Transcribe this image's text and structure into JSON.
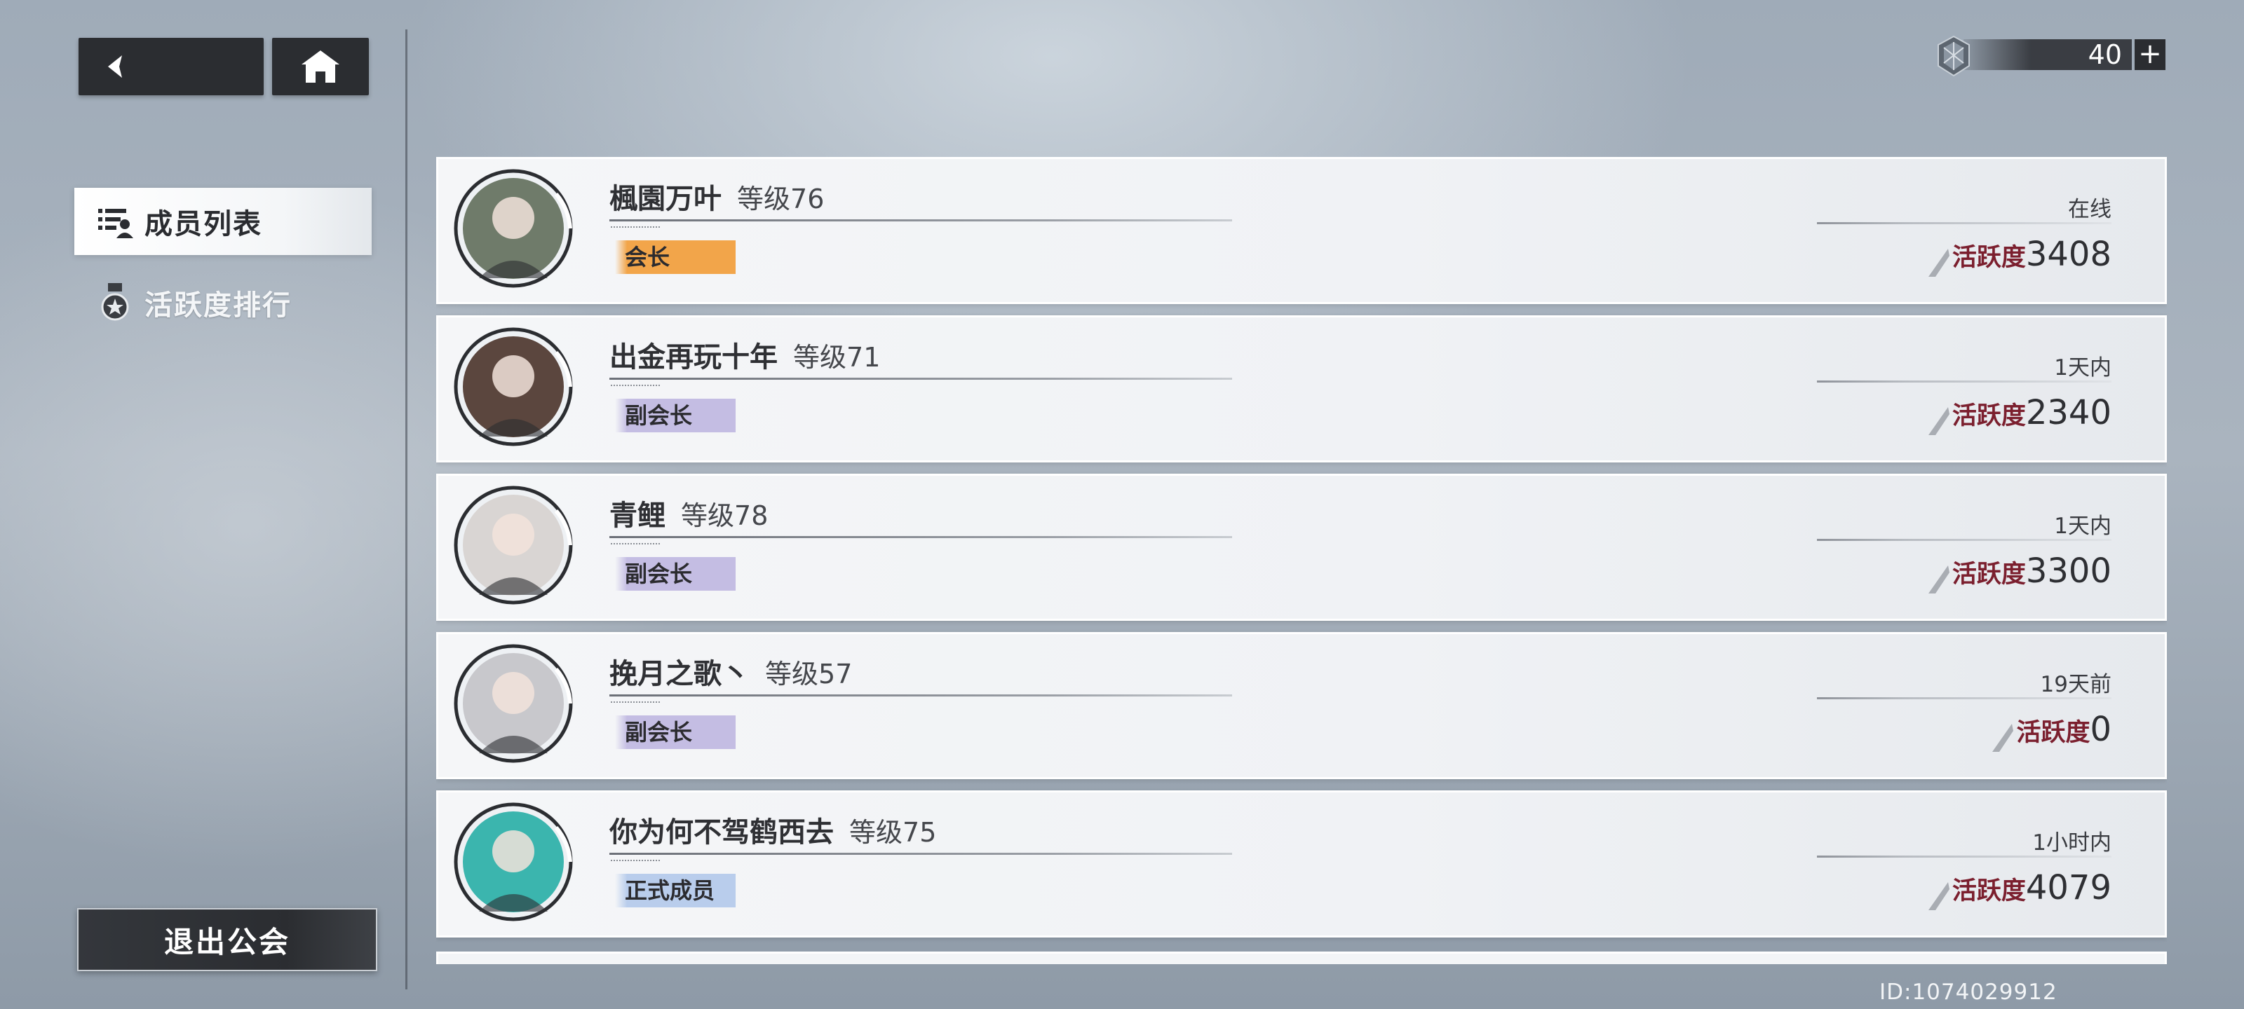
{
  "nav": {
    "items": [
      {
        "label": "成员列表",
        "active": true,
        "icon": "member-list-icon"
      },
      {
        "label": "活跃度排行",
        "active": false,
        "icon": "medal-icon"
      }
    ],
    "quit_label": "退出公会"
  },
  "currency": {
    "value": "40",
    "icon": "gem-icon",
    "plus_icon": "plus-icon"
  },
  "level_prefix": "等级",
  "activity_label": "活跃度",
  "members": [
    {
      "name": "楓園万叶",
      "level": "76",
      "role": "会长",
      "status": "在线",
      "activity": "3408",
      "role_color": "#f2a54a",
      "avatar_color": "#6f7b6a"
    },
    {
      "name": "出金再玩十年",
      "level": "71",
      "role": "副会长",
      "status": "1天内",
      "activity": "2340",
      "role_color": "#c4bde3",
      "avatar_color": "#5b463e"
    },
    {
      "name": "青鲤",
      "level": "78",
      "role": "副会长",
      "status": "1天内",
      "activity": "3300",
      "role_color": "#c4bde3",
      "avatar_color": "#d9d5d3"
    },
    {
      "name": "挽月之歌丶",
      "level": "57",
      "role": "副会长",
      "status": "19天前",
      "activity": "0",
      "role_color": "#c4bde3",
      "avatar_color": "#c8c8cc"
    },
    {
      "name": "你为何不驾鹤西去",
      "level": "75",
      "role": "正式成员",
      "status": "1小时内",
      "activity": "4079",
      "role_color": "#b9cdec",
      "avatar_color": "#3bb5ae"
    }
  ],
  "user_id": "ID:1074029912"
}
